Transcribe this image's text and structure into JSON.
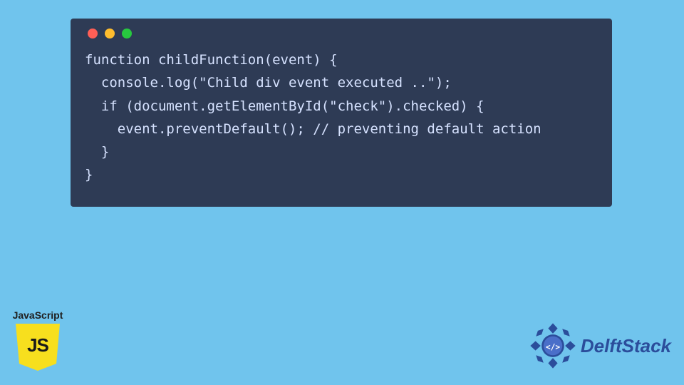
{
  "code": {
    "line1": "function childFunction(event) {",
    "line2": "  console.log(\"Child div event executed ..\");",
    "line3": "  if (document.getElementById(\"check\").checked) {",
    "line4": "    event.preventDefault(); // preventing default action",
    "line5": "  }",
    "line6": "}"
  },
  "jsBadge": {
    "label": "JavaScript",
    "shield": "JS"
  },
  "brand": {
    "name": "DelftStack"
  },
  "colors": {
    "pageBg": "#70c4ed",
    "windowBg": "#2e3b55",
    "codeText": "#d6e2ff",
    "jsYellow": "#f7df1e",
    "brandBlue": "#2b4d9b"
  }
}
